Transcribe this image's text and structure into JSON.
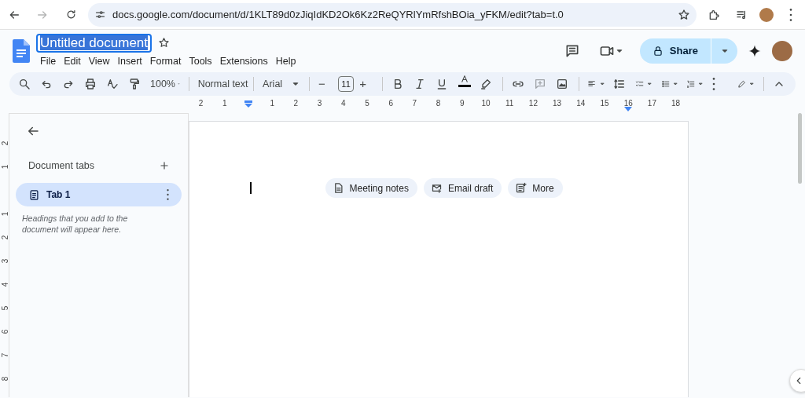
{
  "browser": {
    "url": "docs.google.com/document/d/1KLT89d0zJiqIdKD2Ok6Kz2ReQYRlYmRfshBOia_yFKM/edit?tab=t.0",
    "forward_disabled": true,
    "bookmarked": false
  },
  "header": {
    "title": "Untitled document",
    "title_highlighted": true,
    "starred": false,
    "menus": [
      "File",
      "Edit",
      "View",
      "Insert",
      "Format",
      "Tools",
      "Extensions",
      "Help"
    ],
    "share_label": "Share"
  },
  "toolbar": {
    "zoom": "100%",
    "style": "Normal text",
    "font": "Arial",
    "font_size": "11",
    "decrease": "−",
    "increase": "+"
  },
  "ruler": {
    "left_numbers": [
      "2",
      "1"
    ],
    "right_numbers": [
      "1",
      "2",
      "3",
      "4",
      "5",
      "6",
      "7",
      "8",
      "9",
      "10",
      "11",
      "12",
      "13",
      "14",
      "15",
      "16",
      "17",
      "18"
    ],
    "vertical_above": [
      "2",
      "1"
    ],
    "vertical_below": [
      "1",
      "2",
      "3",
      "4",
      "5",
      "6",
      "7",
      "8"
    ]
  },
  "sidebar": {
    "heading": "Document tabs",
    "tabs": [
      {
        "label": "Tab 1",
        "selected": true
      }
    ],
    "hint": "Headings that you add to the document will appear here."
  },
  "document": {
    "chips": [
      {
        "kind": "notes",
        "label": "Meeting notes"
      },
      {
        "kind": "email",
        "label": "Email draft"
      },
      {
        "kind": "more",
        "label": "More"
      }
    ]
  }
}
